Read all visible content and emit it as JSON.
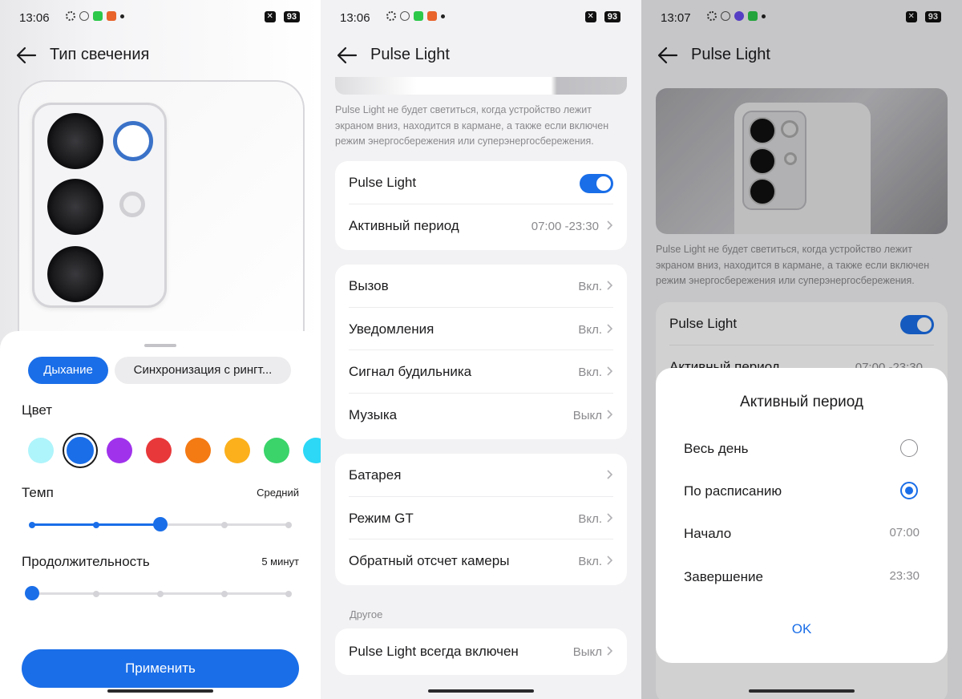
{
  "status_left": {
    "time": "13:06",
    "battery": "93"
  },
  "status_middle": {
    "time": "13:06",
    "battery": "93"
  },
  "status_right": {
    "time": "13:07",
    "battery": "93"
  },
  "screen1": {
    "title": "Тип свечения",
    "tabs": [
      {
        "label": "Дыхание",
        "active": true
      },
      {
        "label": "Синхронизация с рингт...",
        "active": false
      }
    ],
    "color_label": "Цвет",
    "colors": [
      "#aef4fb",
      "#1a6ee8",
      "#a032ec",
      "#e8383a",
      "#f47a14",
      "#fbb01c",
      "#3ad46a",
      "#2cd8f6"
    ],
    "selected_color_index": 1,
    "tempo": {
      "label": "Темп",
      "value": "Средний",
      "level": 2,
      "steps": 5
    },
    "duration": {
      "label": "Продолжительность",
      "value": "5 минут",
      "level": 0,
      "steps": 5
    },
    "apply_label": "Применить"
  },
  "screen2": {
    "title": "Pulse Light",
    "note": "Pulse Light не будет светиться, когда устройство лежит экраном вниз, находится в кармане, а также если включен режим энергосбережения или суперэнергосбережения.",
    "main": {
      "toggle_label": "Pulse Light",
      "toggle_on": true,
      "active_period_label": "Активный период",
      "active_period_value": "07:00 -23:30"
    },
    "notifications": [
      {
        "label": "Вызов",
        "value": "Вкл."
      },
      {
        "label": "Уведомления",
        "value": "Вкл."
      },
      {
        "label": "Сигнал будильника",
        "value": "Вкл."
      },
      {
        "label": "Музыка",
        "value": "Выкл"
      }
    ],
    "other_settings": [
      {
        "label": "Батарея",
        "value": ""
      },
      {
        "label": "Режим GT",
        "value": "Вкл."
      },
      {
        "label": "Обратный отсчет камеры",
        "value": "Вкл."
      }
    ],
    "section_other": "Другое",
    "always_on": {
      "label": "Pulse Light всегда включен",
      "value": "Выкл"
    }
  },
  "screen3": {
    "title": "Pulse Light",
    "note": "Pulse Light не будет светиться, когда устройство лежит экраном вниз, находится в кармане, а также если включен режим энергосбережения или суперэнергосбережения.",
    "toggle_label": "Pulse Light",
    "partial_row_label": "Активный период",
    "partial_row_value": "07:00 -23:30",
    "dialog": {
      "title": "Активный период",
      "options": [
        {
          "label": "Весь день",
          "selected": false
        },
        {
          "label": "По расписанию",
          "selected": true
        }
      ],
      "start_label": "Начало",
      "start_value": "07:00",
      "end_label": "Завершение",
      "end_value": "23:30",
      "ok_label": "OK"
    }
  }
}
